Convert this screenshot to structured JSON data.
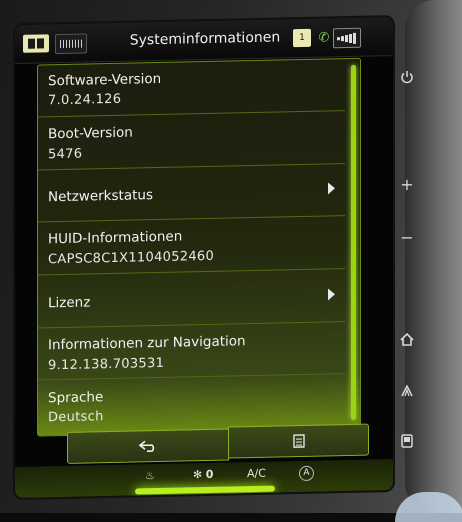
{
  "header": {
    "title": "Systeminformationen",
    "notify_badge": "1"
  },
  "items": [
    {
      "label": "Software-Version",
      "value": "7.0.24.126",
      "has_arrow": false
    },
    {
      "label": "Boot-Version",
      "value": "5476",
      "has_arrow": false
    },
    {
      "label": "Netzwerkstatus",
      "value": "",
      "has_arrow": true
    },
    {
      "label": "HUID-Informationen",
      "value": "CAPSC8C1X1104052460",
      "has_arrow": false
    },
    {
      "label": "Lizenz",
      "value": "",
      "has_arrow": true
    },
    {
      "label": "Informationen zur Navigation",
      "value": "9.12.138.703531",
      "has_arrow": false
    },
    {
      "label": "Sprache",
      "value": "Deutsch",
      "has_arrow": false
    }
  ],
  "bottom": {
    "back_icon": "back-arrow-icon",
    "list_icon": "list-icon"
  },
  "climate": {
    "fan_level": "0",
    "ac_label": "A/C",
    "auto_label": "A"
  },
  "side_buttons": {
    "plus": "+",
    "minus": "−"
  },
  "colors": {
    "accent": "#9ad414",
    "panel_bg": "#1b1d0e",
    "text": "#f1f1f1"
  }
}
